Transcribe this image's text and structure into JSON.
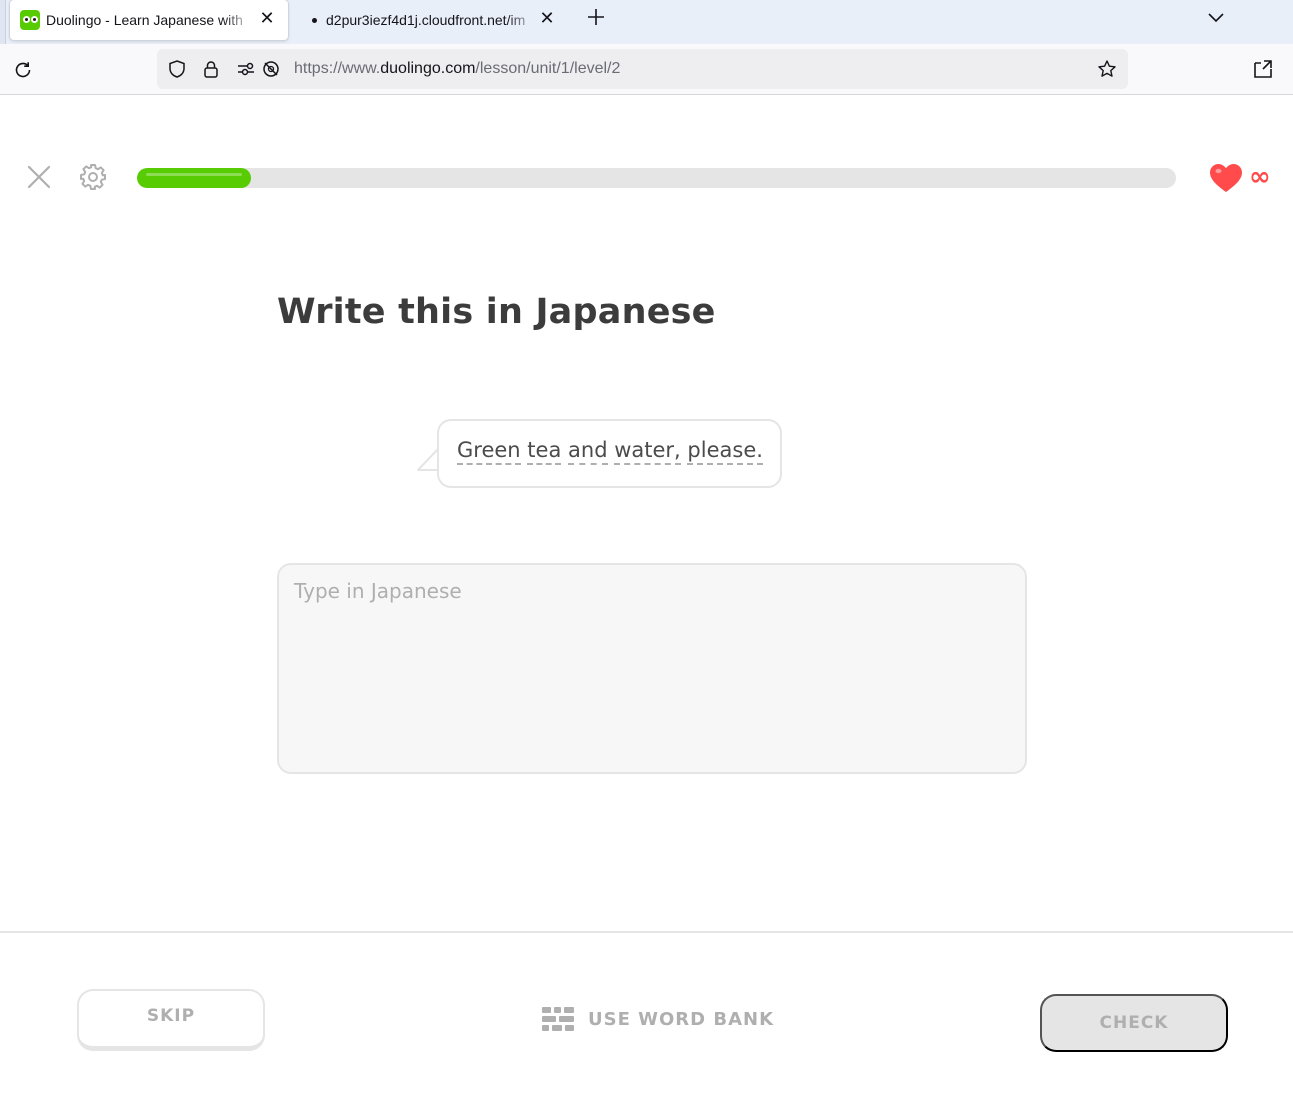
{
  "browser": {
    "tabs": [
      {
        "title": "Duolingo - Learn Japanese with",
        "close": "✕",
        "active": true
      },
      {
        "title": "d2pur3iezf4d1j.cloudfront.net/im",
        "close": "✕",
        "active": false
      }
    ],
    "new_tab": "+",
    "url": {
      "scheme": "https://www.",
      "host": "duolingo.com",
      "path": "/lesson/unit/1/level/2"
    },
    "icons": {
      "reload": "reload-icon",
      "shield": "shield-icon",
      "lock": "lock-icon",
      "permissions": "permissions-icon",
      "tracking": "tracking-protection-icon",
      "bookmark": "star-icon",
      "share": "share-icon",
      "tab_list": "chevron-down-icon"
    }
  },
  "lesson": {
    "progress_fraction": 0.11,
    "hearts": "∞",
    "colors": {
      "progress": "#58cc02",
      "heart": "#ff4b4b",
      "text": "#3c3c3c",
      "muted": "#afafaf"
    },
    "icons": {
      "close": "close-icon",
      "settings": "gear-icon",
      "heart": "heart-icon"
    }
  },
  "challenge": {
    "heading": "Write this in Japanese",
    "prompt_words": [
      "Green",
      "tea",
      "and",
      "water,",
      "please."
    ],
    "answer_value": "",
    "answer_placeholder": "Type in Japanese"
  },
  "footer": {
    "skip_label": "SKIP",
    "word_bank_label": "USE WORD BANK",
    "check_label": "CHECK",
    "icons": {
      "word_bank": "word-bank-icon"
    }
  }
}
